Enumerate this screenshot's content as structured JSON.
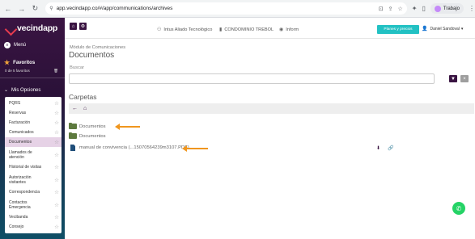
{
  "browser": {
    "url": "app.vecindapp.co/#/app/communications/archives",
    "profile": "Trabajo"
  },
  "sidebar": {
    "logo": "vecindapp",
    "menu_label": "Menú",
    "favorites_label": "Favoritos",
    "favorites_count": "0 de 5 favoritos",
    "options_label": "Mis Opciones",
    "items": [
      {
        "label": "PQRS"
      },
      {
        "label": "Reservas"
      },
      {
        "label": "Facturación"
      },
      {
        "label": "Comunicados"
      },
      {
        "label": "Documentos"
      },
      {
        "label": "Llamados de\natención"
      },
      {
        "label": "Historial de visitas"
      },
      {
        "label": "Autorización\nvisitantes"
      },
      {
        "label": "Correspondencia"
      },
      {
        "label": "Contactos\nEmergencia"
      },
      {
        "label": "Vecibanda"
      },
      {
        "label": "Consejo"
      }
    ]
  },
  "header": {
    "company": "Intus Aliado Tecnológico",
    "condo": "CONDOMINIO TREBOL",
    "role": "Inform",
    "plans_button": "Planes y precios",
    "user_name": "Daniel Sandoval"
  },
  "main": {
    "breadcrumb": "Módulo de Comunicaciones",
    "title": "Documentos",
    "search_label": "Buscar",
    "search_value": "",
    "folders_title": "Carpetas",
    "rows": [
      {
        "name": "Documentos",
        "type": "folder"
      },
      {
        "name": "Documentos",
        "type": "folder"
      },
      {
        "name": "manual de convivencia (...15070564239m3107.PDF)",
        "type": "file"
      }
    ]
  },
  "colors": {
    "brand": "#3a1442",
    "accent": "#22c1c3",
    "annotation_arrow": "#f0961e",
    "folder": "#5d7a3e",
    "whatsapp": "#25d366"
  },
  "icons": {
    "download": "download-icon",
    "link": "link-icon",
    "whatsapp": "whatsapp-icon"
  }
}
